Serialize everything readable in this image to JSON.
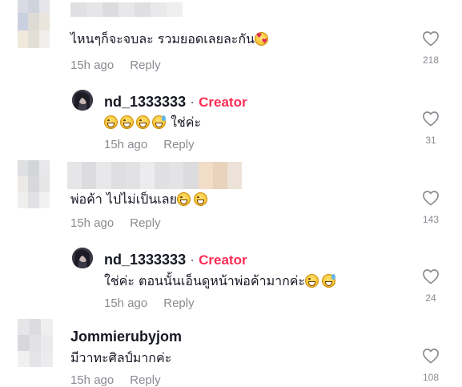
{
  "comments": [
    {
      "name": "",
      "text": "ไหนๆก็จะจบละ รวมยอดเลยละกัน",
      "emojis": [
        "love"
      ],
      "time": "15h ago",
      "reply": "Reply",
      "likes": "218",
      "replies": [
        {
          "name": "nd_1333333",
          "badge": "Creator",
          "text": "ใช่ค่ะ",
          "emojis_before": [
            "grin",
            "grin",
            "grin",
            "sweat"
          ],
          "time": "15h ago",
          "reply": "Reply",
          "likes": "31"
        }
      ]
    },
    {
      "name": "",
      "text": "พ่อค้า ไปไม่เป็นเลย",
      "emojis": [
        "grin",
        "grin"
      ],
      "time": "15h ago",
      "reply": "Reply",
      "likes": "143",
      "replies": [
        {
          "name": "nd_1333333",
          "badge": "Creator",
          "text": "ใช่ค่ะ ตอนนั้นเอ็นดูหน้าพ่อค้ามากค่ะ",
          "emojis": [
            "grin",
            "sweat"
          ],
          "time": "15h ago",
          "reply": "Reply",
          "likes": "24"
        }
      ]
    },
    {
      "name": "Jommierubyjom",
      "text": "มีวาทะศิลป์มากค่ะ",
      "time": "15h ago",
      "reply": "Reply",
      "likes": "108"
    }
  ],
  "icons": {
    "like": "heart-outline-icon"
  },
  "colors": {
    "creator_badge": "#fe2c55",
    "meta_text": "#8a8b91",
    "primary_text": "#161823"
  },
  "separator": "·"
}
